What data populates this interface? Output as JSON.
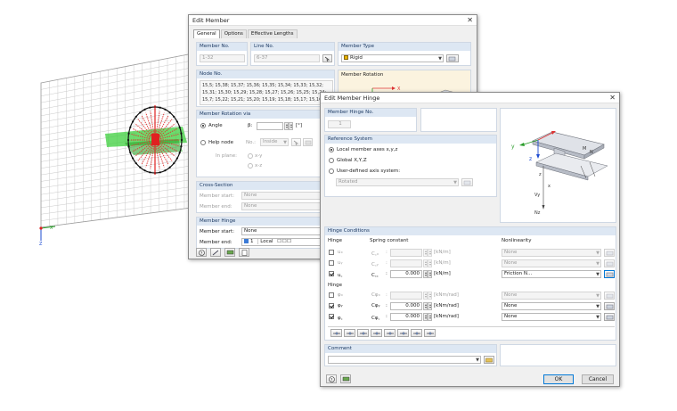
{
  "edit_member": {
    "title": "Edit Member",
    "tabs": [
      "General",
      "Options",
      "Effective Lengths"
    ],
    "member_no": {
      "label": "Member No.",
      "value": "1-32"
    },
    "line_no": {
      "label": "Line No.",
      "value": "6-37"
    },
    "member_type": {
      "label": "Member Type",
      "value": "Rigid",
      "swatch": "#e8b400"
    },
    "node_no": {
      "label": "Node No.",
      "lines": [
        "15,5; 15,38; 15,37; 15,36; 15,35; 15,34; 15,33; 15,32;",
        "15,31; 15,30; 15,29; 15,28; 15,27; 15,26; 15,25; 15,24;",
        "15,7; 15,22; 15,21; 15,20; 15,19; 15,18; 15,17; 15,16;"
      ]
    },
    "member_rotation_head": "Member Rotation",
    "rotation_via": {
      "label": "Member Rotation via",
      "angle_label": "Angle",
      "beta_label": "β:",
      "unit": "[°]",
      "help_node_label": "Help node",
      "no_label": "No.:",
      "inside_value": "Inside",
      "in_plane_label": "In plane:",
      "plane_xy": "x-y",
      "plane_xz": "x-z"
    },
    "cross_section": {
      "label": "Cross-Section",
      "start_label": "Member start:",
      "start_value": "None",
      "end_label": "Member end:",
      "end_value": "None"
    },
    "member_hinge": {
      "label": "Member Hinge",
      "start_label": "Member start:",
      "start_value": "None",
      "end_label": "Member end:",
      "end_no": "1",
      "end_sys": "Local",
      "swatch": "#3b7ad6"
    }
  },
  "hinge": {
    "title": "Edit Member Hinge",
    "hinge_no": {
      "label": "Member Hinge No.",
      "value": "1"
    },
    "reference": {
      "label": "Reference System",
      "opt1": "Local member axes x,y,z",
      "opt2": "Global X,Y,Z",
      "opt3": "User-defined axis system:",
      "rotated_value": "Rotated"
    },
    "conditions": {
      "label": "Hinge Conditions",
      "hinge_col": "Hinge",
      "spring_col": "Spring constant",
      "nonlin_col": "Nonlinearity",
      "translational": [
        {
          "sym": "uₓ",
          "c": "C꜀ₓ",
          "value": "",
          "unit": "[kN/m]",
          "nonlin": "None",
          "checked": false,
          "enabled": false
        },
        {
          "sym": "uᵧ",
          "c": "C꜀ᵧ",
          "value": "",
          "unit": "[kN/m]",
          "nonlin": "None",
          "checked": false,
          "enabled": false
        },
        {
          "sym": "u꜀",
          "c": "C꜀꜀",
          "value": "0.000",
          "unit": "[kN/m]",
          "nonlin": "Friction N...",
          "checked": true,
          "enabled": true
        }
      ],
      "rotational": [
        {
          "sym": "φₓ",
          "c": "Cφₓ",
          "value": "",
          "unit": "[kNm/rad]",
          "nonlin": "None",
          "checked": false,
          "enabled": false
        },
        {
          "sym": "φᵧ",
          "c": "Cφᵧ",
          "value": "0.000",
          "unit": "[kNm/rad]",
          "nonlin": "None",
          "checked": true,
          "enabled": true
        },
        {
          "sym": "φ꜀",
          "c": "Cφ꜀",
          "value": "0.000",
          "unit": "[kNm/rad]",
          "nonlin": "None",
          "checked": true,
          "enabled": true
        }
      ]
    },
    "comment_label": "Comment",
    "ok_label": "OK",
    "cancel_label": "Cancel",
    "preview_axes": {
      "y": "y",
      "z": "z",
      "x": "x",
      "vy": "Vy",
      "nz": "Nz",
      "m": "M",
      "n": "N"
    }
  },
  "viewport": {
    "axis_x": "X",
    "axis_z": "Z"
  }
}
